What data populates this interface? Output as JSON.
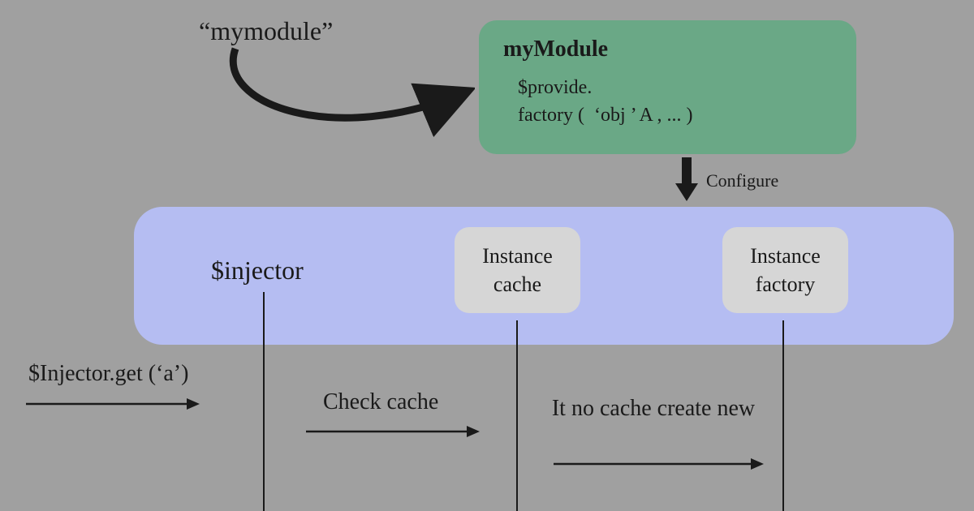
{
  "top": {
    "mymodule_quoted": "“mymodule”",
    "green_title": "myModule",
    "green_line1": "$provide.",
    "green_line2": "factory (  ‘obj ’ A , ... )",
    "configure": "Configure"
  },
  "middle": {
    "injector": "$injector",
    "cache_line1": "Instance",
    "cache_line2": "cache",
    "factory_line1": "Instance",
    "factory_line2": "factory"
  },
  "bottom": {
    "injector_get": "$Injector.get (‘a’)",
    "check_cache": "Check cache",
    "no_cache": "It no cache create new"
  },
  "colors": {
    "bg": "#a0a0a0",
    "green": "#6aa886",
    "blue": "#b5bdf2",
    "grey": "#d6d6d6",
    "text": "#1a1a1a"
  }
}
